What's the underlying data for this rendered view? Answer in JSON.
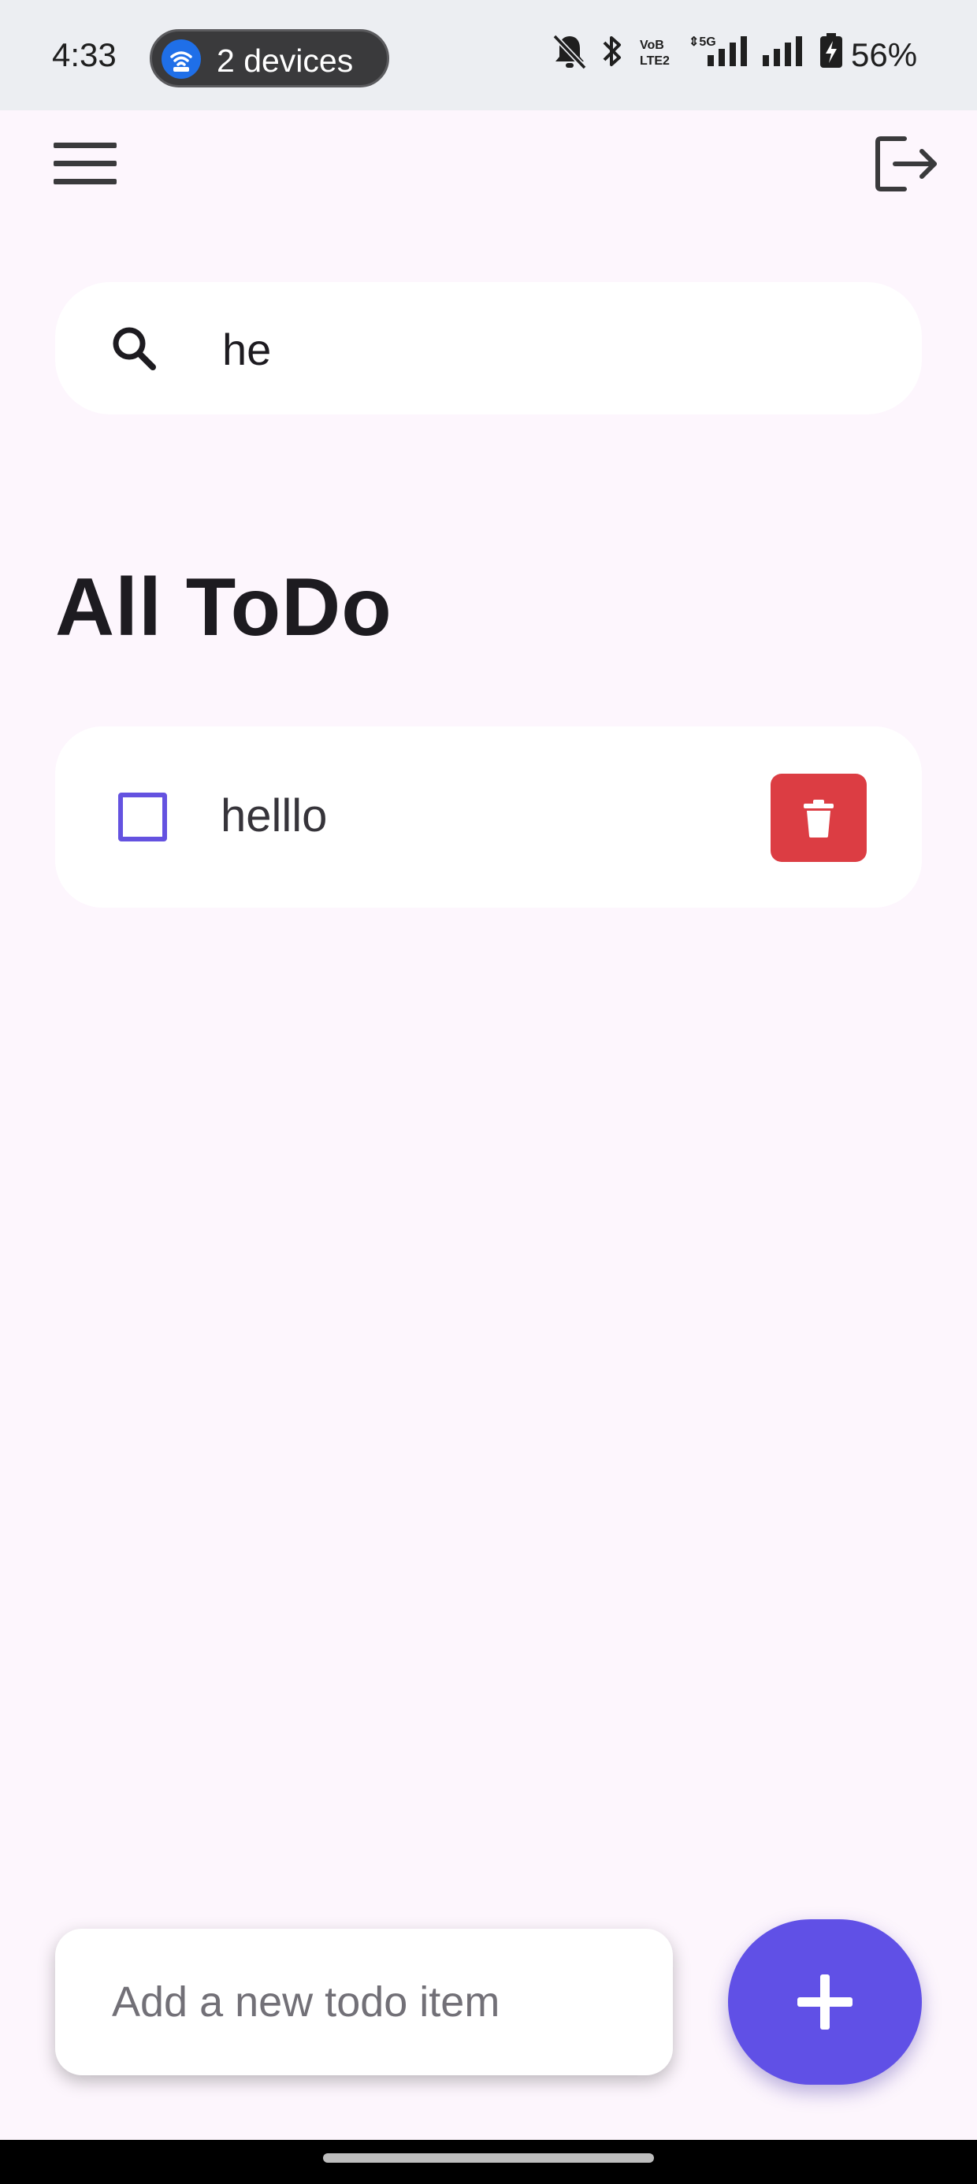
{
  "status_bar": {
    "time": "4:33",
    "hotspot_label": "2 devices",
    "battery": "56%"
  },
  "search": {
    "value": "he"
  },
  "title": "All ToDo",
  "todos": [
    {
      "text": "helllo",
      "checked": false
    }
  ],
  "composer": {
    "placeholder": "Add a new todo item"
  },
  "colors": {
    "accent": "#6050e6",
    "delete": "#dc3d43",
    "background": "#fdf6fd",
    "app_bar": "#eceef2"
  }
}
